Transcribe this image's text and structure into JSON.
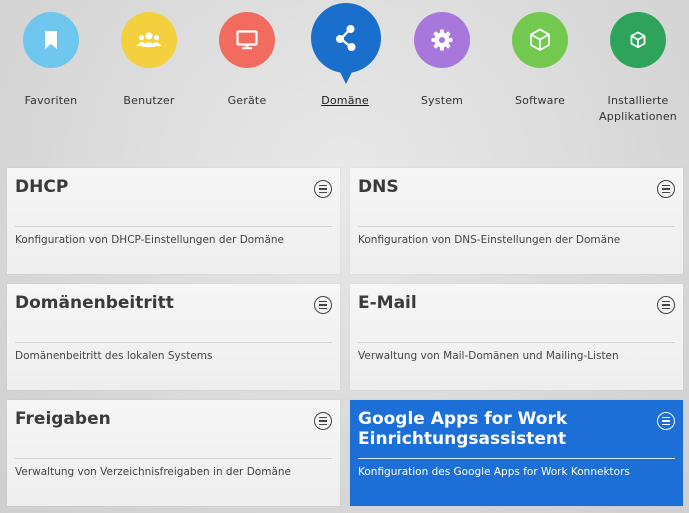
{
  "categories": [
    {
      "label": "Favoriten",
      "icon": "bookmark-icon",
      "color": "#6fc6ee"
    },
    {
      "label": "Benutzer",
      "icon": "users-icon",
      "color": "#f4d03f"
    },
    {
      "label": "Geräte",
      "icon": "monitor-icon",
      "color": "#f16b5f"
    },
    {
      "label": "Domäne",
      "icon": "network-icon",
      "color": "#1b6fcc",
      "active": true
    },
    {
      "label": "System",
      "icon": "gear-icon",
      "color": "#a877dc"
    },
    {
      "label": "Software",
      "icon": "package-icon",
      "color": "#73c94f"
    },
    {
      "label": "Installierte Applikationen",
      "icon": "package-icon",
      "color": "#2ea35a"
    }
  ],
  "tiles": [
    {
      "title": "DHCP",
      "description": "Konfiguration von DHCP-Einstellungen der Domäne"
    },
    {
      "title": "DNS",
      "description": "Konfiguration von DNS-Einstellungen der Domäne"
    },
    {
      "title": "Domänenbeitritt",
      "description": "Domänenbeitritt des lokalen Systems"
    },
    {
      "title": "E-Mail",
      "description": "Verwaltung von Mail-Domänen und Mailing-Listen"
    },
    {
      "title": "Freigaben",
      "description": "Verwaltung von Verzeichnisfreigaben in der Domäne"
    },
    {
      "title": "Google Apps for Work Einrichtungsassistent",
      "description": "Konfiguration des Google Apps for Work Konnektors",
      "highlighted": true
    }
  ],
  "colors": {
    "accent": "#1c6fd6"
  }
}
